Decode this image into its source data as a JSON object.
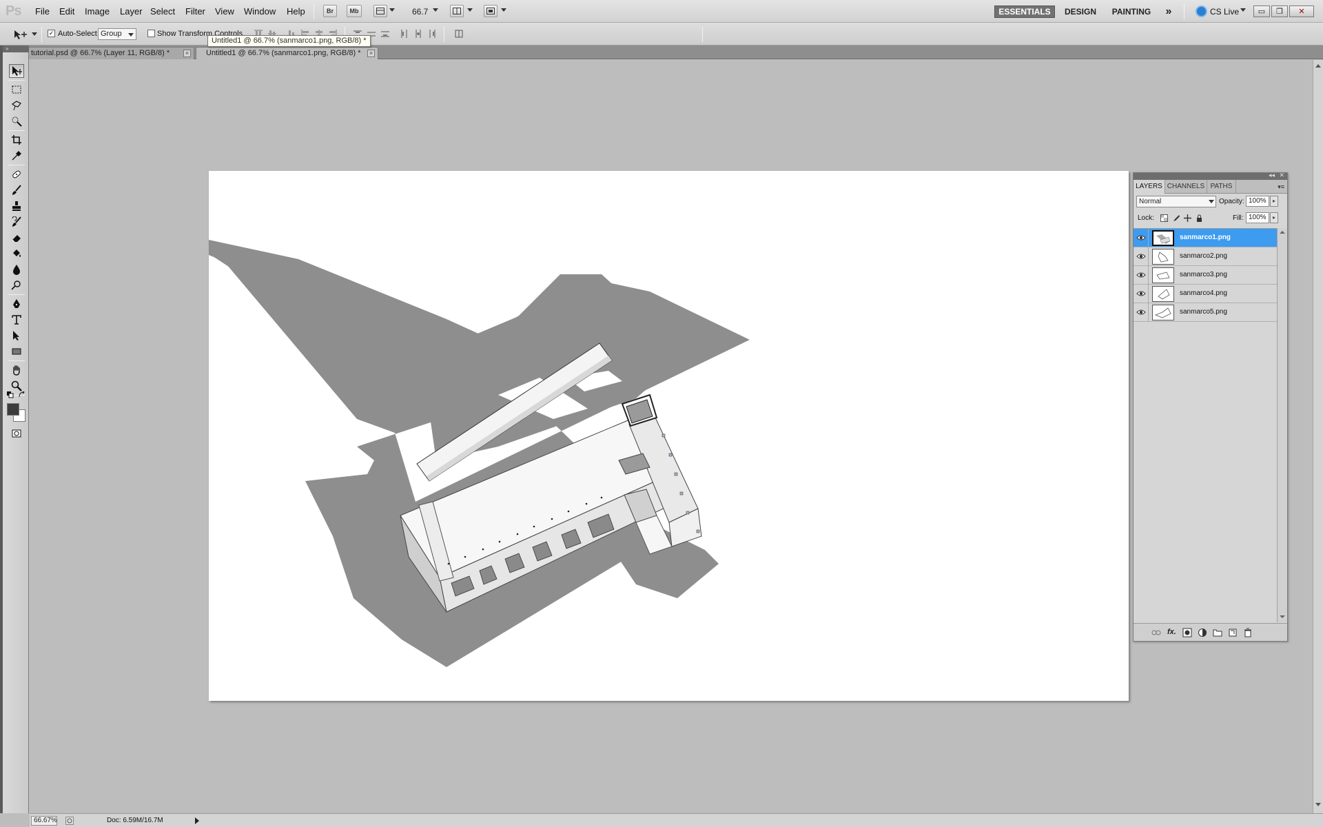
{
  "app": {
    "logo": "Ps"
  },
  "menu": {
    "items": [
      "File",
      "Edit",
      "Image",
      "Layer",
      "Select",
      "Filter",
      "View",
      "Window",
      "Help"
    ],
    "bridge_label": "Br",
    "minibridge_label": "Mb",
    "zoom_value": "66.7"
  },
  "workspaces": {
    "items": [
      "ESSENTIALS",
      "DESIGN",
      "PAINTING"
    ],
    "active": "ESSENTIALS",
    "more": "»",
    "cs_live": "CS Live"
  },
  "window_controls": {
    "minimize": "▭",
    "restore": "❐",
    "close": "✕"
  },
  "options": {
    "auto_select_label": "Auto-Select:",
    "auto_select_checked": "✓",
    "auto_select_value": "Group",
    "show_transform_label": "Show Transform Controls"
  },
  "tooltip": {
    "text": "Untitled1 @ 66.7% (sanmarco1.png, RGB/8) *"
  },
  "tabs": [
    {
      "label": "tutorial.psd @ 66.7% (Layer 11, RGB/8) *",
      "active": false
    },
    {
      "label": "Untitled1 @ 66.7% (sanmarco1.png, RGB/8) *",
      "active": true
    }
  ],
  "tab_close_glyph": "×",
  "tools": [
    "move-tool-icon",
    "marquee-tool-icon",
    "lasso-tool-icon",
    "quick-selection-tool-icon",
    "crop-tool-icon",
    "eyedropper-tool-icon",
    "healing-brush-tool-icon",
    "brush-tool-icon",
    "clone-stamp-tool-icon",
    "history-brush-tool-icon",
    "eraser-tool-icon",
    "paint-bucket-tool-icon",
    "blur-tool-icon",
    "dodge-tool-icon",
    "pen-tool-icon",
    "type-tool-icon",
    "path-selection-tool-icon",
    "rectangle-tool-icon",
    "hand-tool-icon",
    "zoom-tool-icon"
  ],
  "colors": {
    "foreground": "#3c3c3c",
    "background": "#ffffff",
    "selection": "#3d9bf0",
    "shadow": "#8c8c8c"
  },
  "status": {
    "zoom": "66.67%",
    "doc": "Doc: 6.59M/16.7M"
  },
  "layers_panel": {
    "tabs": [
      "LAYERS",
      "CHANNELS",
      "PATHS"
    ],
    "active_tab": "LAYERS",
    "blend_mode": "Normal",
    "opacity_label": "Opacity:",
    "opacity_value": "100%",
    "lock_label": "Lock:",
    "fill_label": "Fill:",
    "fill_value": "100%",
    "layers": [
      {
        "name": "sanmarco1.png",
        "selected": true
      },
      {
        "name": "sanmarco2.png",
        "selected": false
      },
      {
        "name": "sanmarco3.png",
        "selected": false
      },
      {
        "name": "sanmarco4.png",
        "selected": false
      },
      {
        "name": "sanmarco5.png",
        "selected": false
      }
    ],
    "fx_label": "fx."
  }
}
